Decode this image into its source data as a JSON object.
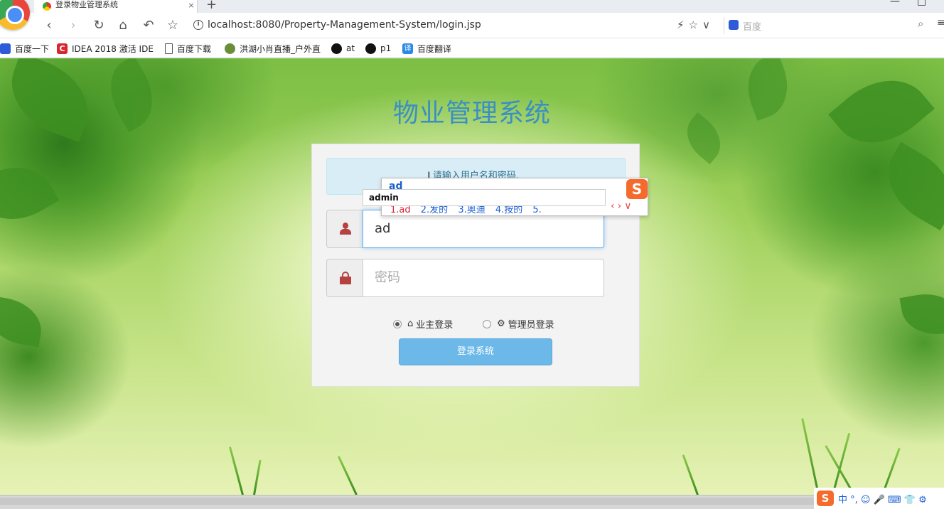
{
  "browser": {
    "tab_title": "登录物业管理系统",
    "tab_close": "×",
    "new_tab": "+",
    "url": "localhost:8080/Property-Management-System/login.jsp",
    "search_placeholder": "百度",
    "nav": {
      "back": "‹",
      "forward": "›",
      "reload": "↻",
      "home": "⌂",
      "undo": "↶",
      "star": "☆"
    },
    "url_actions": "⚡☆∨",
    "window": {
      "minimize": "—",
      "maximize": "□"
    }
  },
  "bookmarks": [
    {
      "label": "百度一下",
      "icon": "baidu-icon"
    },
    {
      "label": "IDEA 2018 激活 IDE",
      "icon": "idea-icon"
    },
    {
      "label": "百度下载",
      "icon": "document-icon"
    },
    {
      "label": "洪湖小肖直播_户外直",
      "icon": "leaf-icon"
    },
    {
      "label": "at",
      "icon": "github-icon"
    },
    {
      "label": "p1",
      "icon": "github-icon"
    },
    {
      "label": "百度翻译",
      "icon": "translate-icon"
    }
  ],
  "page": {
    "title": "物业管理系统",
    "alert": "请输入用户名和密码.",
    "username_value": "ad",
    "password_placeholder": "密码",
    "roles": [
      {
        "label": "业主登录",
        "icon": "home-icon",
        "selected": true
      },
      {
        "label": "管理员登录",
        "icon": "gear-icon",
        "selected": false
      }
    ],
    "submit_label": "登录系统"
  },
  "autocomplete": {
    "suggestion": "admin"
  },
  "ime": {
    "composition": "ad",
    "candidates": [
      "1.ad",
      "2.发的",
      "3.奥迪",
      "4.按的",
      "5."
    ],
    "logo": "S",
    "nav": "‹›∨"
  },
  "tray": {
    "logo": "S",
    "items": "中 °, ☺ 🎤 ⌨ 👕 ⚙"
  },
  "colors": {
    "title": "#3a8fc4",
    "alert_bg": "#d9edf7",
    "alert_text": "#31708f",
    "button": "#6cb8e8",
    "icon": "#b54141"
  }
}
